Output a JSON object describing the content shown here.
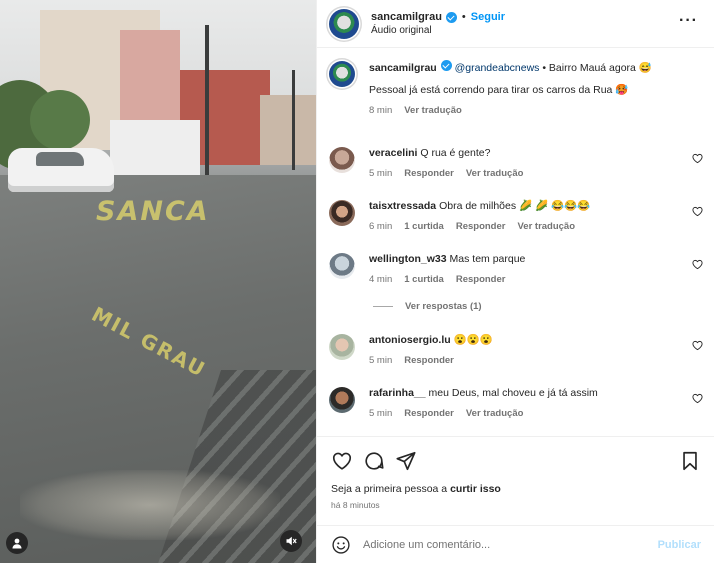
{
  "media": {
    "watermark_top": "SANCA",
    "watermark_bottom": "MIL GRAU",
    "user_icon": "user-tag-icon",
    "mute_icon": "speaker-muted-icon"
  },
  "header": {
    "username": "sancamilgrau",
    "separator": "•",
    "follow_label": "Seguir",
    "audio_label": "Áudio original",
    "more_label": "···"
  },
  "caption": {
    "username": "sancamilgrau",
    "mention": "@grandeabcnews",
    "line1_rest": " • Bairro Mauá agora 😅",
    "line2": "Pessoal já está correndo para tirar os carros da Rua 🥵",
    "time": "8 min",
    "translate": "Ver tradução"
  },
  "comments": [
    {
      "username": "veracelini",
      "text": "Q rua é gente?",
      "time": "5 min",
      "likes": "",
      "reply": "Responder",
      "translate": "Ver tradução"
    },
    {
      "username": "taisxtressada",
      "text": "Obra de milhões 🌽 🌽 😂😂😂",
      "time": "6 min",
      "likes": "1 curtida",
      "reply": "Responder",
      "translate": "Ver tradução"
    },
    {
      "username": "wellington_w33",
      "text": "Mas tem parque",
      "time": "4 min",
      "likes": "1 curtida",
      "reply": "Responder",
      "translate": ""
    },
    {
      "username": "antoniosergio.lu",
      "text": "😮😮😮",
      "time": "5 min",
      "likes": "",
      "reply": "Responder",
      "translate": ""
    },
    {
      "username": "rafarinha__",
      "text": "meu Deus, mal choveu e já tá assim",
      "time": "5 min",
      "likes": "",
      "reply": "Responder",
      "translate": "Ver tradução"
    }
  ],
  "view_replies": "Ver respostas (1)",
  "actions": {
    "icons": [
      "heart-icon",
      "comment-icon",
      "share-icon",
      "bookmark-icon"
    ],
    "likes_prefix": "Seja a primeira pessoa a ",
    "likes_bold": "curtir isso",
    "posted_ago": "há 8 minutos"
  },
  "composer": {
    "placeholder": "Adicione um comentário...",
    "post_label": "Publicar"
  },
  "colors": {
    "accent": "#0095f6",
    "verified": "#1d9bf0",
    "muted_text": "#737373",
    "post_disabled": "#b2dffc"
  }
}
